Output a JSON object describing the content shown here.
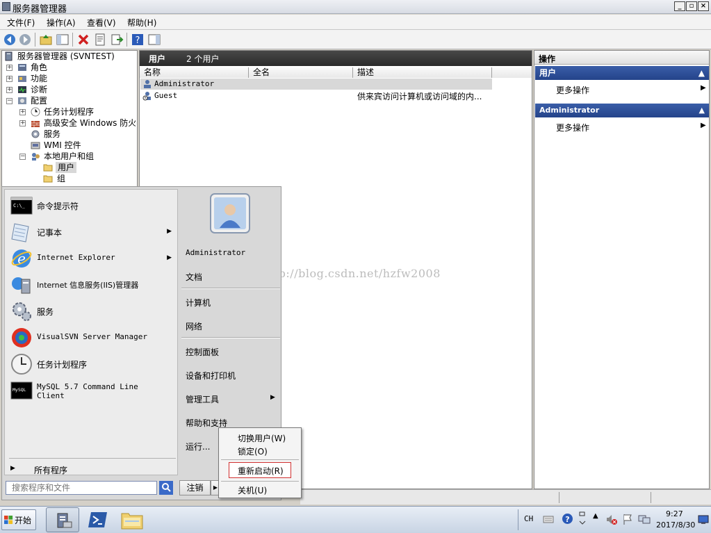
{
  "window": {
    "title": "服务器管理器"
  },
  "menu": [
    "文件(F)",
    "操作(A)",
    "查看(V)",
    "帮助(H)"
  ],
  "tree": {
    "root": "服务器管理器 (SVNTEST)",
    "roles": "角色",
    "features": "功能",
    "diagnostics": "诊断",
    "config": "配置",
    "task_scheduler": "任务计划程序",
    "firewall": "高级安全 Windows 防火墙",
    "services": "服务",
    "wmi": "WMI 控件",
    "local_users": "本地用户和组",
    "users": "用户",
    "groups": "组"
  },
  "center": {
    "header_title": "用户",
    "header_count": "2 个用户",
    "columns": [
      "名称",
      "全名",
      "描述"
    ],
    "rows": [
      {
        "name": "Administrator",
        "fullname": "",
        "desc": ""
      },
      {
        "name": "Guest",
        "fullname": "",
        "desc": "供来宾访问计算机或访问域的内..."
      }
    ]
  },
  "actions": {
    "title": "操作",
    "section1": "用户",
    "section1_item": "更多操作",
    "section2": "Administrator",
    "section2_item": "更多操作"
  },
  "start_menu": {
    "pinned": [
      {
        "label": "命令提示符",
        "icon": "cmd-icon",
        "arrow": false
      },
      {
        "label": "记事本",
        "icon": "notepad-icon",
        "arrow": true
      },
      {
        "label": "Internet Explorer",
        "icon": "ie-icon",
        "arrow": true
      },
      {
        "label": "Internet 信息服务(IIS)管理器",
        "icon": "iis-icon",
        "arrow": false
      },
      {
        "label": "服务",
        "icon": "services-icon",
        "arrow": false
      },
      {
        "label": "VisualSVN Server Manager",
        "icon": "visualsvn-icon",
        "arrow": false
      },
      {
        "label": "任务计划程序",
        "icon": "clock-icon",
        "arrow": false
      },
      {
        "label": "MySQL 5.7 Command Line Client",
        "icon": "mysql-icon",
        "arrow": false
      }
    ],
    "all_programs": "所有程序",
    "search_placeholder": "搜索程序和文件",
    "right": {
      "user": "Administrator",
      "documents": "文档",
      "computer": "计算机",
      "network": "网络",
      "control_panel": "控制面板",
      "devices": "设备和打印机",
      "admin_tools": "管理工具",
      "help": "帮助和支持",
      "run": "运行..."
    },
    "logoff": "注销"
  },
  "shutdown_menu": {
    "switch_user": "切换用户(W)",
    "lock": "锁定(O)",
    "restart": "重新启动(R)",
    "shutdown": "关机(U)"
  },
  "watermark": "http://blog.csdn.net/hzfw2008",
  "taskbar": {
    "start": "开始",
    "lang": "CH",
    "time": "9:27",
    "date": "2017/8/30"
  },
  "colors": {
    "accent": "#2a4a94",
    "highlight_border": "#d03030"
  }
}
